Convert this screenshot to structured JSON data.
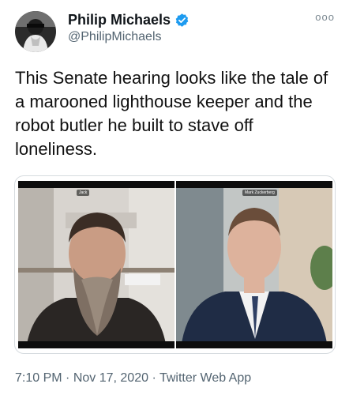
{
  "user": {
    "display_name": "Philip Michaels",
    "handle": "@PhilipMichaels"
  },
  "tweet": {
    "text": "This Senate hearing looks like the tale of a marooned lighthouse keeper and the robot butler he built to stave off loneliness.",
    "more_label": "ooo"
  },
  "media": {
    "left_caption": "Jack",
    "right_caption": "Mark Zuckerberg"
  },
  "meta": {
    "time": "7:10 PM",
    "separator": " · ",
    "date": "Nov 17, 2020",
    "source": "Twitter Web App"
  },
  "colors": {
    "verified_badge": "#1d9bf0",
    "secondary_text": "#536471"
  }
}
